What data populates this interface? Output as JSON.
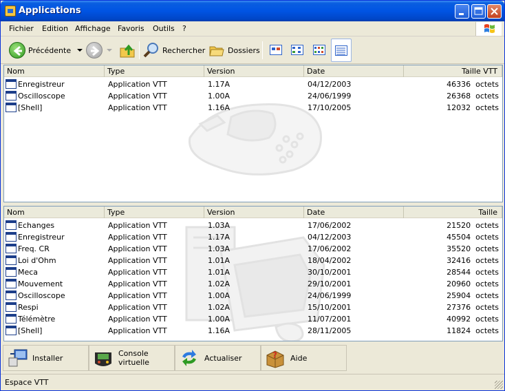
{
  "window": {
    "title": "Applications"
  },
  "menu": [
    "Fichier",
    "Edition",
    "Affichage",
    "Favoris",
    "Outils",
    "?"
  ],
  "toolbar": {
    "back_label": "Précédente",
    "search_label": "Rechercher",
    "folders_label": "Dossiers"
  },
  "top_pane": {
    "columns": [
      "Nom",
      "Type",
      "Version",
      "Date",
      "Taille VTT"
    ],
    "rows": [
      {
        "name": "Enregistreur",
        "type": "Application VTT",
        "version": "1.17A",
        "date": "04/12/2003",
        "size": "46336  octets"
      },
      {
        "name": "Oscilloscope",
        "type": "Application VTT",
        "version": "1.00A",
        "date": "24/06/1999",
        "size": "26368  octets"
      },
      {
        "name": "[Shell]",
        "type": "Application VTT",
        "version": "1.16A",
        "date": "17/10/2005",
        "size": "12032  octets"
      }
    ]
  },
  "bottom_pane": {
    "columns": [
      "Nom",
      "Type",
      "Version",
      "Date",
      "Taille"
    ],
    "rows": [
      {
        "name": "Echanges",
        "type": "Application VTT",
        "version": "1.03A",
        "date": "17/06/2002",
        "size": "21520  octets"
      },
      {
        "name": "Enregistreur",
        "type": "Application VTT",
        "version": "1.17A",
        "date": "04/12/2003",
        "size": "45504  octets"
      },
      {
        "name": "Freq. CR",
        "type": "Application VTT",
        "version": "1.03A",
        "date": "17/06/2002",
        "size": "35520  octets"
      },
      {
        "name": "Loi d'Ohm",
        "type": "Application VTT",
        "version": "1.01A",
        "date": "18/04/2002",
        "size": "32416  octets"
      },
      {
        "name": "Meca",
        "type": "Application VTT",
        "version": "1.01A",
        "date": "30/10/2001",
        "size": "28544  octets"
      },
      {
        "name": "Mouvement",
        "type": "Application VTT",
        "version": "1.02A",
        "date": "29/10/2001",
        "size": "20960  octets"
      },
      {
        "name": "Oscilloscope",
        "type": "Application VTT",
        "version": "1.00A",
        "date": "24/06/1999",
        "size": "25904  octets"
      },
      {
        "name": "Respi",
        "type": "Application VTT",
        "version": "1.02A",
        "date": "15/10/2001",
        "size": "27376  octets"
      },
      {
        "name": "Télémètre",
        "type": "Application VTT",
        "version": "1.00A",
        "date": "11/07/2001",
        "size": "40992  octets"
      },
      {
        "name": "[Shell]",
        "type": "Application VTT",
        "version": "1.16A",
        "date": "28/11/2005",
        "size": "11824  octets"
      }
    ]
  },
  "actions": [
    {
      "label": "Installer",
      "icon": "install-icon"
    },
    {
      "label": "Console virtuelle",
      "icon": "console-icon"
    },
    {
      "label": "Actualiser",
      "icon": "refresh-icon"
    },
    {
      "label": "Aide",
      "icon": "help-icon"
    }
  ],
  "status": {
    "text": "Espace VTT"
  }
}
